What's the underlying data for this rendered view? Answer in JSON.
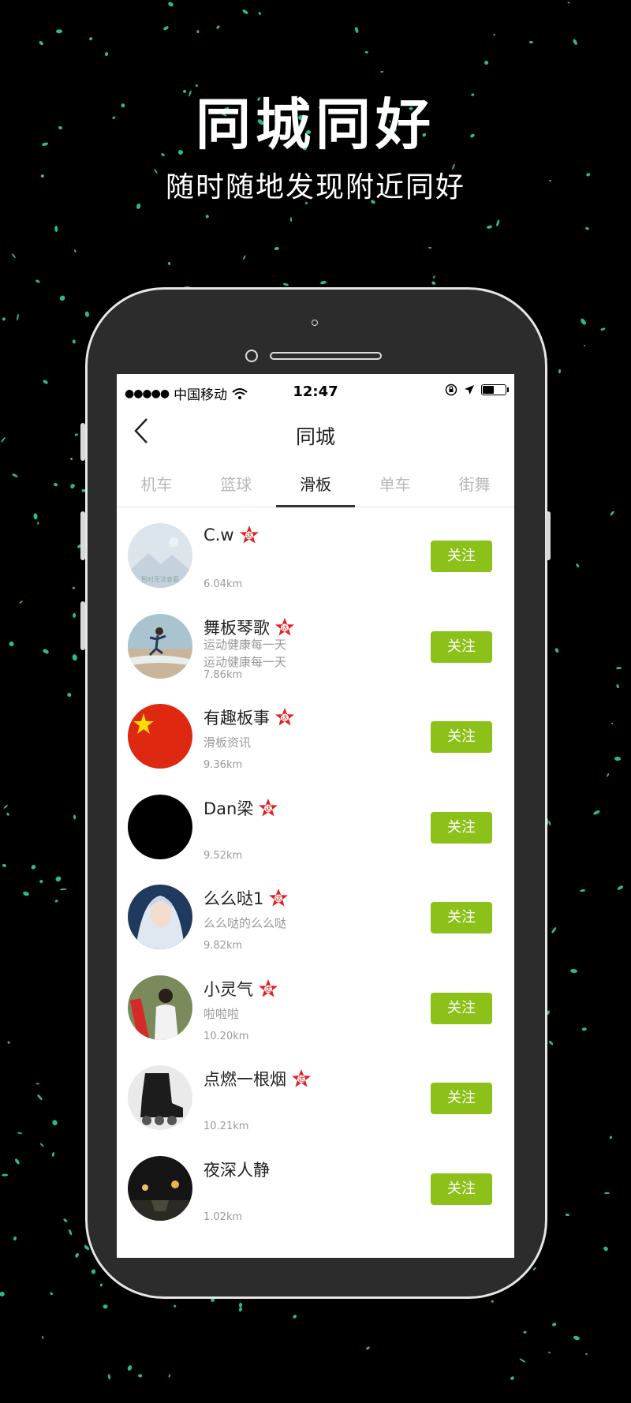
{
  "promo": {
    "title": "同城同好",
    "subtitle": "随时随地发现附近同好"
  },
  "status_bar": {
    "signal_dots": "●●●●●",
    "carrier": "中国移动",
    "time": "12:47",
    "battery_level": 0.5
  },
  "nav": {
    "title": "同城",
    "back_icon": "chevron-left-icon"
  },
  "tabs": [
    {
      "label": "机车"
    },
    {
      "label": "篮球"
    },
    {
      "label": "滑板"
    },
    {
      "label": "单车"
    },
    {
      "label": "街舞"
    }
  ],
  "active_tab": "滑板",
  "badge_text": "达",
  "follow_label": "关注",
  "avatar_placeholder_text": "暂时无法查看",
  "users": [
    {
      "name": "C.w",
      "verified": true,
      "bio": "",
      "distance": "6.04km"
    },
    {
      "name": "舞板琴歌",
      "verified": true,
      "bio": "运动健康每一天\n运动健康每一天",
      "distance": "7.86km"
    },
    {
      "name": "有趣板事",
      "verified": true,
      "bio": "滑板资讯",
      "distance": "9.36km"
    },
    {
      "name": "Dan梁",
      "verified": true,
      "bio": "",
      "distance": "9.52km"
    },
    {
      "name": "么么哒1",
      "verified": true,
      "bio": "么么哒的么么哒",
      "distance": "9.82km"
    },
    {
      "name": "小灵气",
      "verified": true,
      "bio": "啦啦啦",
      "distance": "10.20km"
    },
    {
      "name": "点燃一根烟",
      "verified": true,
      "bio": "",
      "distance": "10.21km"
    },
    {
      "name": "夜深人静",
      "verified": false,
      "bio": "",
      "distance": "1.02km"
    }
  ],
  "colors": {
    "accent_green": "#8cc11a",
    "speckle": "#2fd28f",
    "badge_red": "#e02020"
  }
}
